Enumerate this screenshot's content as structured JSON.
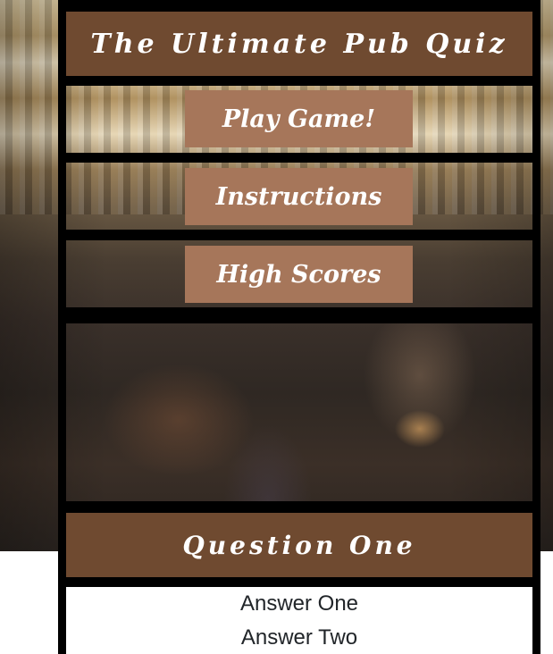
{
  "header": {
    "title": "The Ultimate Pub Quiz"
  },
  "menu": {
    "play_label": "Play Game!",
    "instructions_label": "Instructions",
    "high_scores_label": "High Scores"
  },
  "quiz": {
    "question": "Question One",
    "answers": [
      "Answer One",
      "Answer Two"
    ]
  },
  "colors": {
    "header_bg": "#6f4a30",
    "button_bg": "#a6765a",
    "frame": "#000000"
  }
}
